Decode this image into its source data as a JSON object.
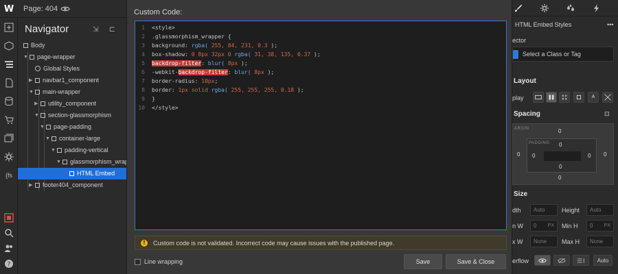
{
  "topbar": {
    "logo": "W",
    "page_label": "Page: 404"
  },
  "navigator": {
    "title": "Navigator",
    "tools": "⇲ ⊏",
    "tree": [
      {
        "label": "Body"
      },
      {
        "label": "page-wrapper"
      },
      {
        "label": "Global Styles"
      },
      {
        "label": "navbar1_component"
      },
      {
        "label": "main-wrapper"
      },
      {
        "label": "utility_component"
      },
      {
        "label": "section-glassmorphism"
      },
      {
        "label": "page-padding"
      },
      {
        "label": "container-large"
      },
      {
        "label": "padding-vertical"
      },
      {
        "label": "glassmorphism_wrapp"
      },
      {
        "label": "HTML Embed"
      },
      {
        "label": "footer404_component"
      }
    ]
  },
  "modal": {
    "title": "Custom Code:",
    "code_lines": [
      {
        "n": "1",
        "parts": [
          {
            "t": "<style>",
            "c": "k"
          }
        ]
      },
      {
        "n": "2",
        "parts": [
          {
            "t": ".glassmorphism_wrapper {",
            "c": "k"
          }
        ]
      },
      {
        "n": "3",
        "parts": [
          {
            "t": "background: ",
            "c": "k"
          },
          {
            "t": "rgba(",
            "c": "fn"
          },
          {
            "t": " 255, 84, 231, 0.3 ",
            "c": "num"
          },
          {
            "t": ");",
            "c": "k"
          }
        ]
      },
      {
        "n": "4",
        "parts": [
          {
            "t": "box-shadow: ",
            "c": "k"
          },
          {
            "t": "0 8px 32px 0 ",
            "c": "num"
          },
          {
            "t": "rgba(",
            "c": "fn"
          },
          {
            "t": " 31, 38, 135, 0.37 ",
            "c": "num"
          },
          {
            "t": ");",
            "c": "k"
          }
        ]
      },
      {
        "n": "5",
        "parts": [
          {
            "t": "backdrop-filter",
            "c": "hl"
          },
          {
            "t": ": ",
            "c": "k"
          },
          {
            "t": "blur(",
            "c": "fn"
          },
          {
            "t": " 8px ",
            "c": "num"
          },
          {
            "t": ");",
            "c": "k"
          }
        ]
      },
      {
        "n": "6",
        "parts": [
          {
            "t": "-webkit-",
            "c": "k"
          },
          {
            "t": "backdrop-filter",
            "c": "hl"
          },
          {
            "t": ": ",
            "c": "k"
          },
          {
            "t": "blur(",
            "c": "fn"
          },
          {
            "t": " 8px ",
            "c": "num"
          },
          {
            "t": ");",
            "c": "k"
          }
        ]
      },
      {
        "n": "7",
        "parts": [
          {
            "t": "border-radius: ",
            "c": "k"
          },
          {
            "t": "10px",
            "c": "num"
          },
          {
            "t": ";",
            "c": "k"
          }
        ]
      },
      {
        "n": "8",
        "parts": [
          {
            "t": "border: ",
            "c": "k"
          },
          {
            "t": "1px solid ",
            "c": "num"
          },
          {
            "t": "rgba(",
            "c": "fn"
          },
          {
            "t": " 255, 255, 255, 0.18 ",
            "c": "num"
          },
          {
            "t": ");",
            "c": "k"
          }
        ]
      },
      {
        "n": "9",
        "parts": [
          {
            "t": "}",
            "c": "k"
          }
        ]
      },
      {
        "n": "10",
        "parts": [
          {
            "t": "</style>",
            "c": "k"
          }
        ]
      }
    ],
    "warning": "Custom code is not validated. Incorrect code may cause issues with the published page.",
    "line_wrapping": "Line wrapping",
    "save": "Save",
    "save_close": "Save & Close"
  },
  "right_panel": {
    "element_label": "HTML Embed Styles",
    "more": "•••",
    "selector_label": "ector",
    "selector_placeholder": "Select a Class or Tag",
    "layout": "Layout",
    "display": "play",
    "spacing": "Spacing",
    "margin_label": "ARGIN",
    "padding_label": "PADDING",
    "margin": {
      "top": "0",
      "left": "0",
      "right": "0",
      "bottom": "0"
    },
    "padding": {
      "top": "0",
      "left": "0",
      "right": "0",
      "bottom": "0"
    },
    "size": "Size",
    "width_label": "dth",
    "width_value": "Auto",
    "height_label": "Height",
    "height_value": "Auto",
    "minw_label": "n W",
    "minw_value": "0",
    "minw_unit": "PX",
    "minh_label": "Min H",
    "minh_value": "0",
    "minh_unit": "PX",
    "maxw_label": "x W",
    "maxw_value": "None",
    "maxh_label": "Max H",
    "maxh_value": "None",
    "overflow": "erflow",
    "overflow_auto": "Auto"
  }
}
